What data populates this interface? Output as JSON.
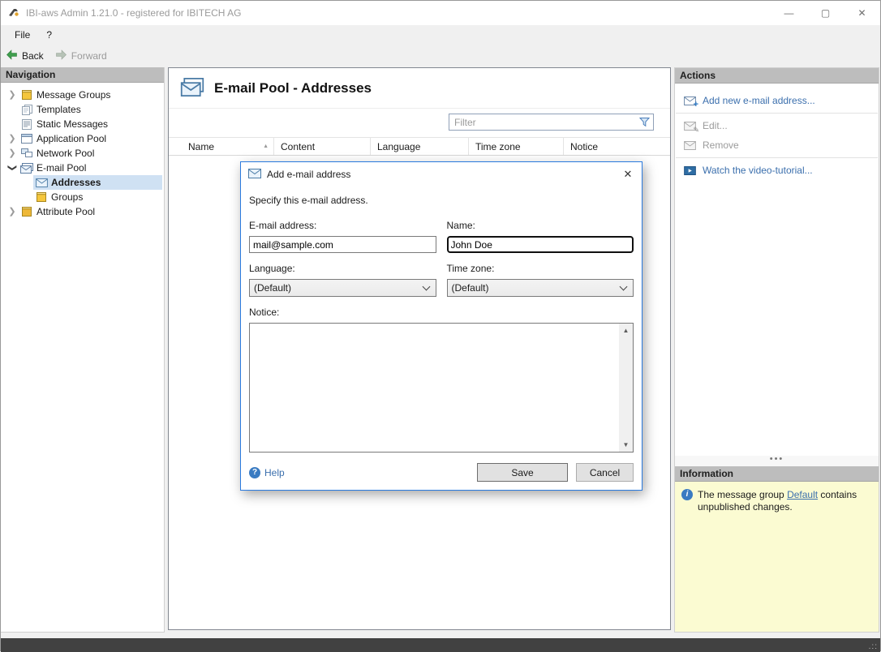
{
  "window": {
    "title": "IBI-aws Admin 1.21.0 - registered for IBITECH AG"
  },
  "menu": {
    "file": "File",
    "help": "?"
  },
  "toolbar": {
    "back": "Back",
    "forward": "Forward"
  },
  "navigation": {
    "header": "Navigation",
    "items": [
      {
        "label": "Message Groups"
      },
      {
        "label": "Templates"
      },
      {
        "label": "Static Messages"
      },
      {
        "label": "Application Pool"
      },
      {
        "label": "Network Pool"
      },
      {
        "label": "E-mail Pool"
      },
      {
        "label": "Addresses"
      },
      {
        "label": "Groups"
      },
      {
        "label": "Attribute Pool"
      }
    ]
  },
  "main": {
    "title": "E-mail Pool - Addresses",
    "filter_placeholder": "Filter",
    "columns": [
      "Name",
      "Content",
      "Language",
      "Time zone",
      "Notice"
    ]
  },
  "dialog": {
    "title": "Add e-mail address",
    "description": "Specify this e-mail address.",
    "email_label": "E-mail address:",
    "email_value": "mail@sample.com",
    "name_label": "Name:",
    "name_value": "John Doe",
    "language_label": "Language:",
    "language_value": "(Default)",
    "timezone_label": "Time zone:",
    "timezone_value": "(Default)",
    "notice_label": "Notice:",
    "notice_value": "",
    "help": "Help",
    "save": "Save",
    "cancel": "Cancel"
  },
  "actions": {
    "header": "Actions",
    "add": "Add new e-mail address...",
    "edit": "Edit...",
    "remove": "Remove",
    "tutorial": "Watch the video-tutorial..."
  },
  "information": {
    "header": "Information",
    "text_before": "The message group ",
    "link": "Default",
    "text_after": " contains unpublished changes."
  },
  "colors": {
    "accent": "#2a7ade",
    "link": "#3b6fad",
    "selection": "#cfe1f3",
    "info_bg": "#fbfbd2",
    "header_bg": "#bdbdbd",
    "statusbar_bg": "#414141"
  }
}
